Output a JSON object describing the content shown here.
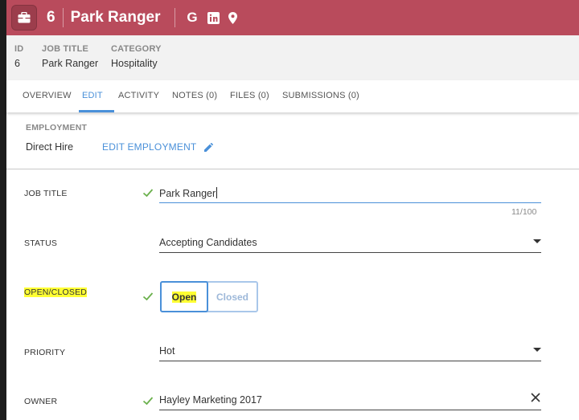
{
  "header": {
    "id": "6",
    "title": "Park Ranger",
    "icons": [
      "briefcase-icon",
      "google-icon",
      "linkedin-icon",
      "map-pin-icon"
    ],
    "google_glyph": "G",
    "color": "#b94b5c"
  },
  "summary": {
    "id_label": "ID",
    "id_value": "6",
    "job_title_label": "JOB TITLE",
    "job_title_value": "Park Ranger",
    "category_label": "CATEGORY",
    "category_value": "Hospitality"
  },
  "tabs": [
    {
      "label": "OVERVIEW",
      "active": false
    },
    {
      "label": "EDIT",
      "active": true
    },
    {
      "label": "ACTIVITY",
      "active": false
    },
    {
      "label": "NOTES (0)",
      "active": false
    },
    {
      "label": "FILES (0)",
      "active": false
    },
    {
      "label": "SUBMISSIONS (0)",
      "active": false
    }
  ],
  "employment": {
    "label": "EMPLOYMENT",
    "type": "Direct Hire",
    "edit_label": "EDIT EMPLOYMENT"
  },
  "form": {
    "job_title": {
      "label": "JOB TITLE",
      "value": "Park Ranger",
      "counter": "11/100"
    },
    "status": {
      "label": "STATUS",
      "value": "Accepting Candidates"
    },
    "open_closed": {
      "label": "OPEN/CLOSED",
      "options": [
        "Open",
        "Closed"
      ],
      "selected": "Open"
    },
    "priority": {
      "label": "PRIORITY",
      "value": "Hot"
    },
    "owner": {
      "label": "OWNER",
      "value": "Hayley Marketing 2017"
    }
  },
  "colors": {
    "accent": "#4a90d9",
    "valid_check": "#6ab04c",
    "highlight": "#ffff33"
  }
}
